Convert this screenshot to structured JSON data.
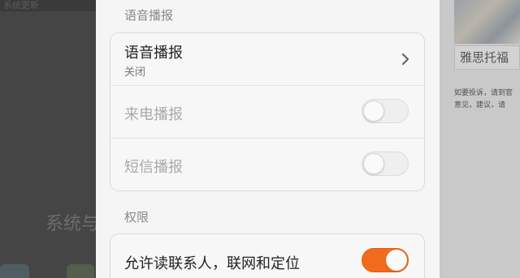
{
  "background": {
    "top_left_text": "系统更新",
    "left_big_text": "系统与",
    "right_title": "雅思托福",
    "right_small_lines": [
      "如要投诉，请到官",
      "意见，建议，请"
    ]
  },
  "sections": {
    "voice": {
      "header": "语音播报",
      "rows": [
        {
          "title": "语音播报",
          "subtitle": "关闭"
        },
        {
          "title": "来电播报"
        },
        {
          "title": "短信播报"
        }
      ]
    },
    "permissions": {
      "header": "权限",
      "rows": [
        {
          "title": "允许读联系人，联网和定位"
        }
      ]
    }
  },
  "toggles": {
    "incoming_call": false,
    "sms": false,
    "contacts_network_location": true
  },
  "colors": {
    "accent": "#f26b1d",
    "sheet_bg": "#f5f5f5",
    "card_border": "#dadada"
  },
  "icons": {
    "row_arrow": "chevron-right-icon"
  }
}
